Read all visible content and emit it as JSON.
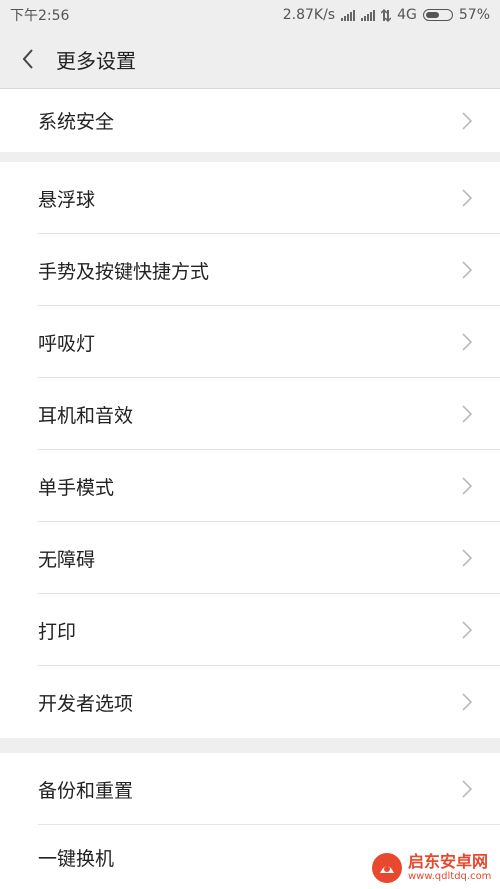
{
  "status_bar": {
    "time": "下午2:56",
    "net_speed": "2.87K/s",
    "network_type": "4G",
    "battery_percent": "57%",
    "battery_level": 0.57
  },
  "header": {
    "title": "更多设置",
    "back_icon": "chevron-left-icon"
  },
  "groups": [
    {
      "items": [
        {
          "label": "系统安全"
        }
      ]
    },
    {
      "items": [
        {
          "label": "悬浮球"
        },
        {
          "label": "手势及按键快捷方式"
        },
        {
          "label": "呼吸灯"
        },
        {
          "label": "耳机和音效"
        },
        {
          "label": "单手模式"
        },
        {
          "label": "无障碍"
        },
        {
          "label": "打印"
        },
        {
          "label": "开发者选项"
        }
      ]
    },
    {
      "items": [
        {
          "label": "备份和重置"
        },
        {
          "label": "一键换机"
        }
      ]
    }
  ],
  "watermark": {
    "title": "启东安卓网",
    "url": "www.qdltdq.com"
  },
  "colors": {
    "background": "#efefef",
    "surface": "#ffffff",
    "text": "#222222",
    "chevron": "#bbbbbb",
    "watermark": "#e8482e"
  }
}
